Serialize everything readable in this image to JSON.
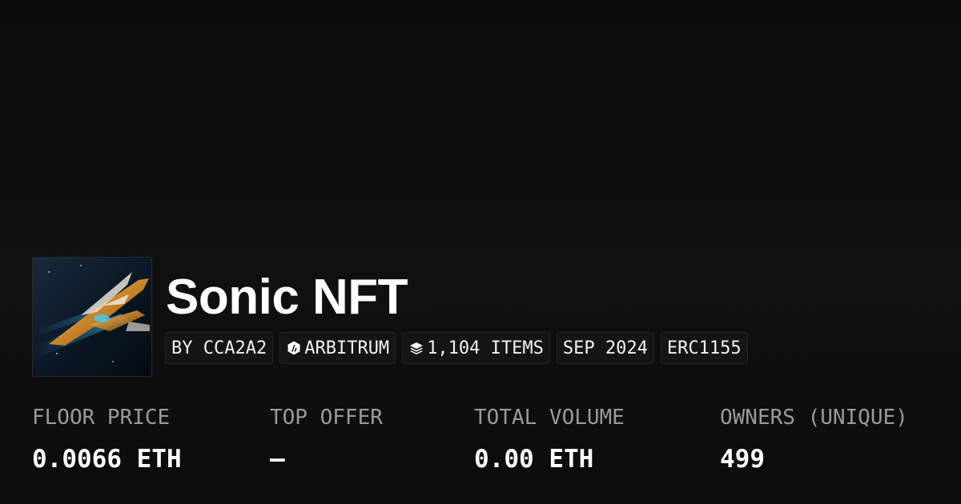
{
  "collection": {
    "title": "Sonic NFT",
    "image_icon": "spaceship-artwork"
  },
  "tags": {
    "creator": "BY CCA2A2",
    "chain": "ARBITRUM",
    "chain_icon": "arbitrum-icon",
    "items": "1,104 ITEMS",
    "items_icon": "layers-icon",
    "date": "SEP 2024",
    "standard": "ERC1155"
  },
  "stats": {
    "floor_price": {
      "label": "FLOOR PRICE",
      "value": "0.0066 ETH"
    },
    "top_offer": {
      "label": "TOP OFFER",
      "value": "–"
    },
    "total_volume": {
      "label": "TOTAL VOLUME",
      "value": "0.00 ETH"
    },
    "owners": {
      "label": "OWNERS (UNIQUE)",
      "value": "499"
    }
  }
}
